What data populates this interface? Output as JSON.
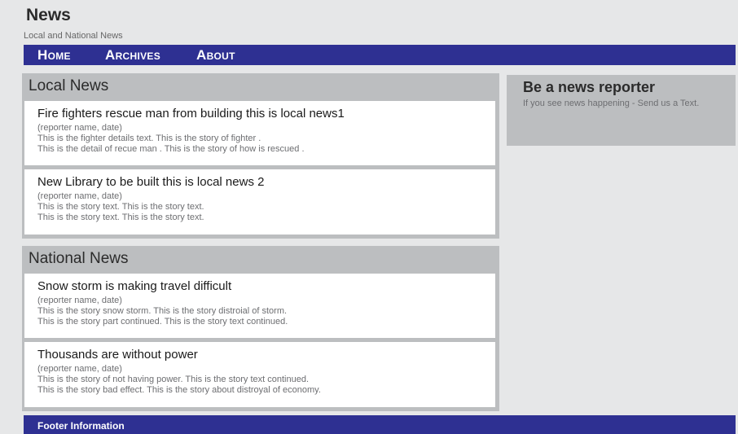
{
  "site": {
    "title": "News",
    "tagline": "Local and National News"
  },
  "nav": {
    "items": [
      {
        "label": "Home"
      },
      {
        "label": "Archives"
      },
      {
        "label": "About"
      }
    ]
  },
  "local_news": {
    "heading": "Local News",
    "stories": [
      {
        "title": "Fire fighters rescue man from building this is local news1",
        "meta": "(reporter name, date)",
        "lines": [
          "This is the fighter details text. This is the story of fighter .",
          "This is the detail of recue man . This is the story of how is rescued ."
        ]
      },
      {
        "title": "New Library to be built this is local news 2",
        "meta": "(reporter name, date)",
        "lines": [
          "This is the story text. This is the story text.",
          "This is the story text. This is the story text."
        ]
      }
    ]
  },
  "national_news": {
    "heading": "National News",
    "stories": [
      {
        "title": "Snow storm is making travel difficult",
        "meta": "(reporter name, date)",
        "lines": [
          "This is the story snow storm. This is the story distroial of storm.",
          "This is the story part continued. This is the story text continued."
        ]
      },
      {
        "title": "Thousands are without power",
        "meta": "(reporter name, date)",
        "lines": [
          "This is the story of not having power. This is the story text continued.",
          "This is the story bad effect. This is the story about distroyal of economy."
        ]
      }
    ]
  },
  "sidebar": {
    "title": "Be a news reporter",
    "text": "If you see news happening - Send us a Text."
  },
  "footer": {
    "text": "Footer Information"
  },
  "colors": {
    "nav_background": "#2e3092",
    "page_background": "#e6e7e8",
    "section_background": "#bcbec0"
  }
}
